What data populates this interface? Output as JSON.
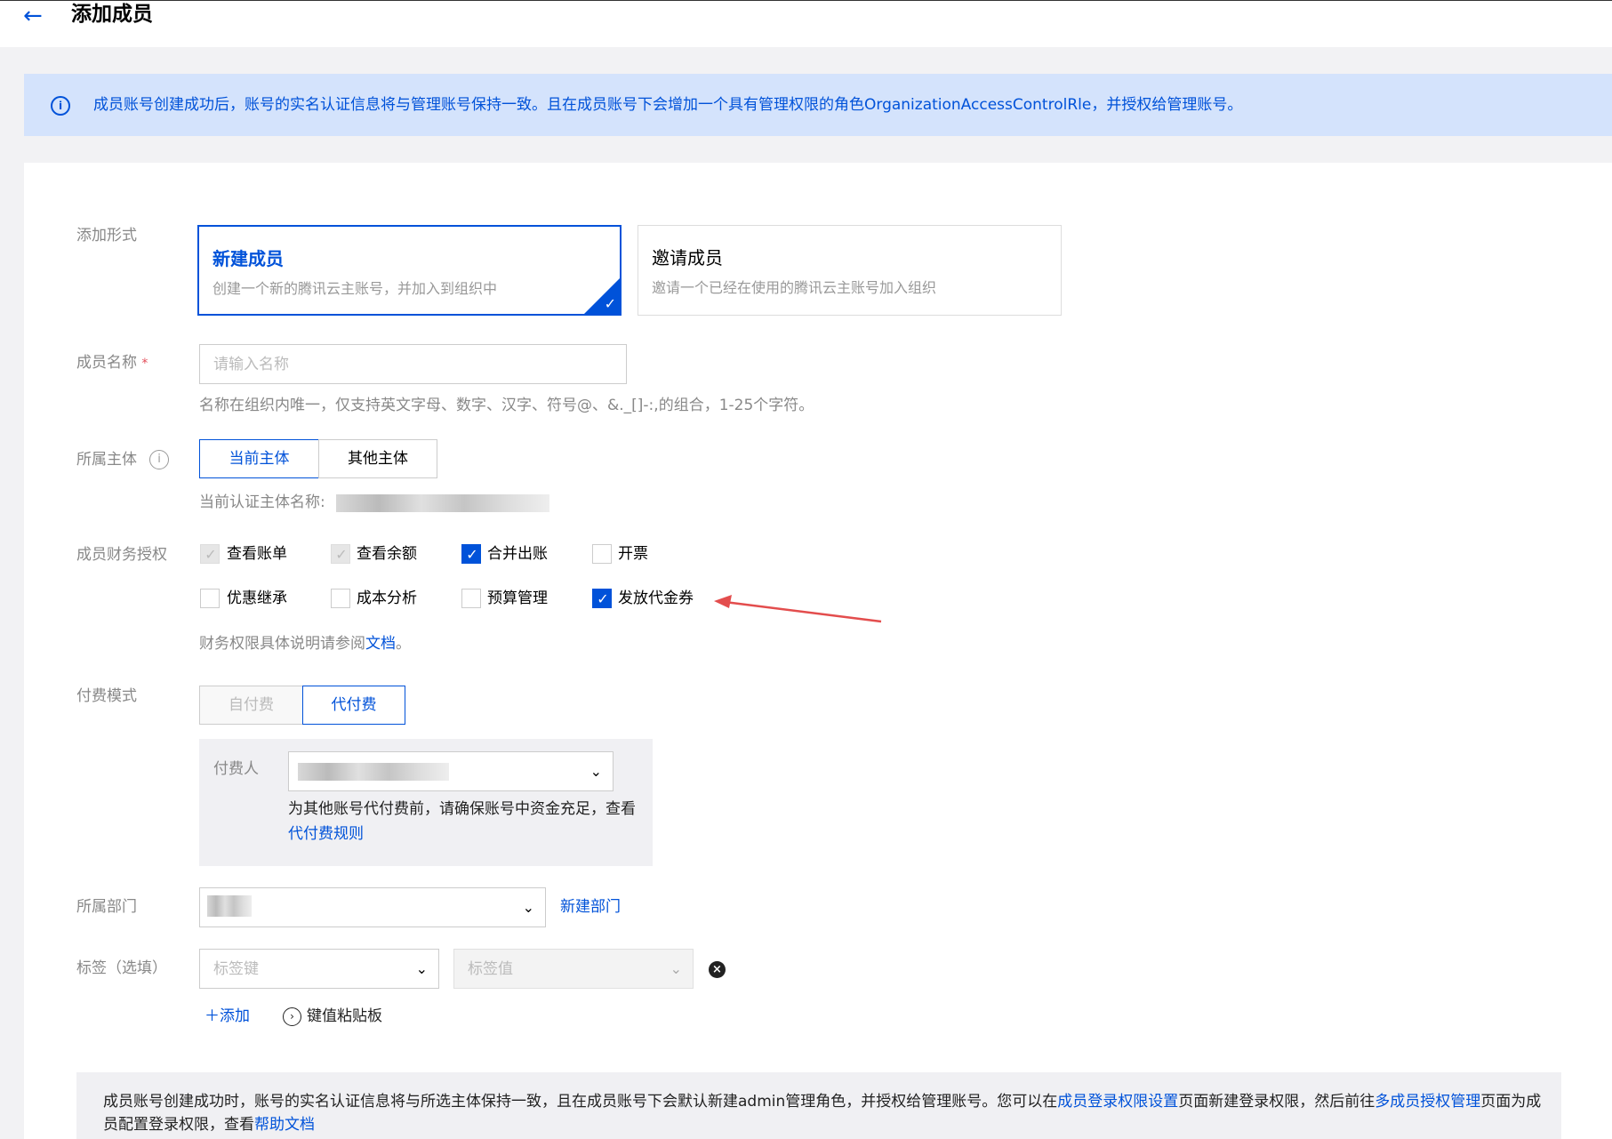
{
  "header": {
    "back_icon": "arrow-left-icon",
    "title": "添加成员"
  },
  "notice": {
    "icon": "info-icon",
    "text": "成员账号创建成功后，账号的实名认证信息将与管理账号保持一致。且在成员账号下会增加一个具有管理权限的角色OrganizationAccessControlRle，并授权给管理账号。"
  },
  "form": {
    "add_type": {
      "label": "添加形式",
      "options": [
        {
          "title": "新建成员",
          "desc": "创建一个新的腾讯云主账号，并加入到组织中",
          "selected": true
        },
        {
          "title": "邀请成员",
          "desc": "邀请一个已经在使用的腾讯云主账号加入组织",
          "selected": false
        }
      ]
    },
    "member_name": {
      "label": "成员名称",
      "required_mark": "*",
      "placeholder": "请输入名称",
      "value": "",
      "hint": "名称在组织内唯一，仅支持英文字母、数字、汉字、符号@、&._[]-:,的组合，1-25个字符。"
    },
    "entity": {
      "label": "所属主体",
      "info_icon": "info-icon",
      "options": [
        "当前主体",
        "其他主体"
      ],
      "selected": "当前主体",
      "current_label": "当前认证主体名称:"
    },
    "finance": {
      "label": "成员财务授权",
      "items": [
        {
          "label": "查看账单",
          "checked": true,
          "disabled": true
        },
        {
          "label": "查看余额",
          "checked": true,
          "disabled": true
        },
        {
          "label": "合并出账",
          "checked": true,
          "disabled": false
        },
        {
          "label": "开票",
          "checked": false,
          "disabled": false
        },
        {
          "label": "优惠继承",
          "checked": false,
          "disabled": false
        },
        {
          "label": "成本分析",
          "checked": false,
          "disabled": false
        },
        {
          "label": "预算管理",
          "checked": false,
          "disabled": false
        },
        {
          "label": "发放代金券",
          "checked": true,
          "disabled": false
        }
      ],
      "hint_prefix": "财务权限具体说明请参阅",
      "hint_link": "文档",
      "hint_suffix": "。"
    },
    "pay_mode": {
      "label": "付费模式",
      "options": [
        "自付费",
        "代付费"
      ],
      "selected": "代付费",
      "payer_label": "付费人",
      "payer_note_prefix": "为其他账号代付费前，请确保账号中资金充足，查看",
      "payer_note_link": "代付费规则"
    },
    "department": {
      "label": "所属部门",
      "new_link": "新建部门"
    },
    "tags": {
      "label": "标签（选填）",
      "key_placeholder": "标签键",
      "value_placeholder": "标签值",
      "remove_icon": "close-circle-icon",
      "add_label": "添加",
      "paste_label": "键值粘贴板"
    }
  },
  "footer_note": {
    "p1": "成员账号创建成功时，账号的实名认证信息将与所选主体保持一致，且在成员账号下会默认新建admin管理角色，并授权给管理账号。您可以在",
    "link1": "成员登录权限设置",
    "p2": "页面新建登录权限，然后前往",
    "link2": "多成员授权管理",
    "p3": "页面为成员配置登录权限，查看",
    "link3": "帮助文档"
  },
  "annotation": {
    "arrow_color": "#e34d4d"
  },
  "colors": {
    "primary": "#0052d9",
    "notice_bg": "#d4e3fc"
  }
}
